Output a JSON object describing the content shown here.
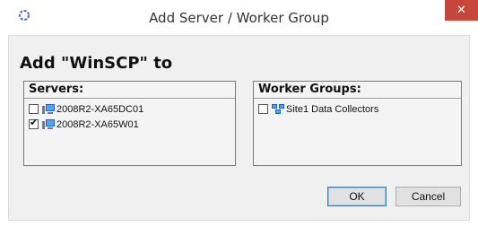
{
  "window": {
    "title": "Add Server / Worker Group",
    "close_glyph": "✕"
  },
  "dialog": {
    "heading": "Add \"WinSCP\" to"
  },
  "servers": {
    "header": "Servers:",
    "items": [
      {
        "label": "2008R2-XA65DC01",
        "checked": false,
        "icon": "server-icon"
      },
      {
        "label": "2008R2-XA65W01",
        "checked": true,
        "icon": "server-icon"
      }
    ]
  },
  "worker_groups": {
    "header": "Worker Groups:",
    "items": [
      {
        "label": "Site1 Data Collectors",
        "checked": false,
        "icon": "worker-group-icon"
      }
    ]
  },
  "buttons": {
    "ok": "OK",
    "cancel": "Cancel"
  },
  "colors": {
    "close_button": "#c7463c",
    "client_background": "#f0f0f0"
  }
}
